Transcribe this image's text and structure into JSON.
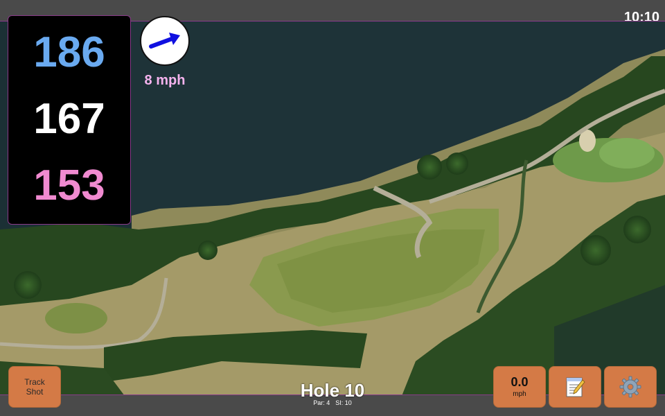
{
  "clock": "10:10",
  "colors": {
    "back_distance": "#6aaaf0",
    "front_distance": "#f08ad0",
    "wind_speed": "#f5b3ee",
    "button": "#d47a46",
    "water": "#1e3338"
  },
  "distances": {
    "back": "186",
    "middle": "167",
    "front": "153"
  },
  "wind": {
    "icon": "arrow-icon",
    "speed": "8 mph"
  },
  "buttons": {
    "track_shot": "Track\nShot",
    "speed_value": "0.0",
    "speed_unit": "mph",
    "notes_icon": "memo-icon",
    "settings_icon": "gear-icon"
  },
  "hole": {
    "title": "Hole 10",
    "par": "Par: 4",
    "si": "SI: 10"
  }
}
